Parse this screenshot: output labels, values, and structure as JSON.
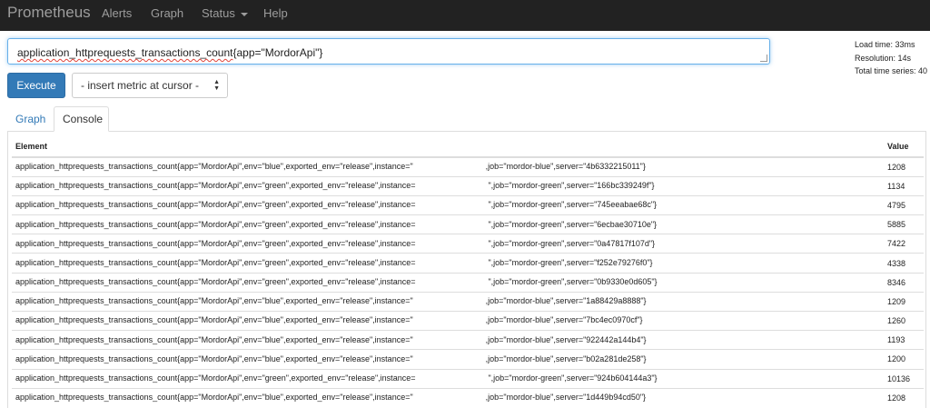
{
  "nav": {
    "brand": "Prometheus",
    "items": [
      "Alerts",
      "Graph",
      "Status",
      "Help"
    ]
  },
  "query": {
    "metric": "application_httprequests_transactions_count",
    "labels": "{app=\"MordorApi\"}"
  },
  "stats": {
    "load_time": "Load time: 33ms",
    "resolution": "Resolution: 14s",
    "total_series": "Total time series: 40"
  },
  "controls": {
    "execute_label": "Execute",
    "metric_select": "- insert metric at cursor -"
  },
  "tabs": {
    "graph": "Graph",
    "console": "Console"
  },
  "table": {
    "headers": {
      "element": "Element",
      "value": "Value"
    },
    "rows": [
      {
        "prefix": "application_httprequests_transactions_count{app=\"MordorApi\",env=\"blue\",exported_env=\"release\",instance=\"",
        "suffix": ",job=\"mordor-blue\",server=\"4b6332215011\"}",
        "value": "1208"
      },
      {
        "prefix": "application_httprequests_transactions_count{app=\"MordorApi\",env=\"green\",exported_env=\"release\",instance=",
        "suffix": "\",job=\"mordor-green\",server=\"166bc339249f\"}",
        "value": "1134"
      },
      {
        "prefix": "application_httprequests_transactions_count{app=\"MordorApi\",env=\"green\",exported_env=\"release\",instance=",
        "suffix": "\",job=\"mordor-green\",server=\"745eeabae68c\"}",
        "value": "4795"
      },
      {
        "prefix": "application_httprequests_transactions_count{app=\"MordorApi\",env=\"green\",exported_env=\"release\",instance=",
        "suffix": "\",job=\"mordor-green\",server=\"6ecbae30710e\"}",
        "value": "5885"
      },
      {
        "prefix": "application_httprequests_transactions_count{app=\"MordorApi\",env=\"green\",exported_env=\"release\",instance=",
        "suffix": "\",job=\"mordor-green\",server=\"0a47817f107d\"}",
        "value": "7422"
      },
      {
        "prefix": "application_httprequests_transactions_count{app=\"MordorApi\",env=\"green\",exported_env=\"release\",instance=",
        "suffix": "\",job=\"mordor-green\",server=\"f252e79276f0\"}",
        "value": "4338"
      },
      {
        "prefix": "application_httprequests_transactions_count{app=\"MordorApi\",env=\"green\",exported_env=\"release\",instance=",
        "suffix": "\",job=\"mordor-green\",server=\"0b9330e0d605\"}",
        "value": "8346"
      },
      {
        "prefix": "application_httprequests_transactions_count{app=\"MordorApi\",env=\"blue\",exported_env=\"release\",instance=\"",
        "suffix": ",job=\"mordor-blue\",server=\"1a88429a8888\"}",
        "value": "1209"
      },
      {
        "prefix": "application_httprequests_transactions_count{app=\"MordorApi\",env=\"blue\",exported_env=\"release\",instance=\"",
        "suffix": ",job=\"mordor-blue\",server=\"7bc4ec0970cf\"}",
        "value": "1260"
      },
      {
        "prefix": "application_httprequests_transactions_count{app=\"MordorApi\",env=\"blue\",exported_env=\"release\",instance=\"",
        "suffix": ",job=\"mordor-blue\",server=\"922442a144b4\"}",
        "value": "1193"
      },
      {
        "prefix": "application_httprequests_transactions_count{app=\"MordorApi\",env=\"blue\",exported_env=\"release\",instance=\"",
        "suffix": ",job=\"mordor-blue\",server=\"b02a281de258\"}",
        "value": "1200"
      },
      {
        "prefix": "application_httprequests_transactions_count{app=\"MordorApi\",env=\"green\",exported_env=\"release\",instance=",
        "suffix": "\",job=\"mordor-green\",server=\"924b604144a3\"}",
        "value": "10136"
      },
      {
        "prefix": "application_httprequests_transactions_count{app=\"MordorApi\",env=\"blue\",exported_env=\"release\",instance=\"",
        "suffix": ",job=\"mordor-blue\",server=\"1d449b94cd50\"}",
        "value": "1208"
      }
    ]
  }
}
